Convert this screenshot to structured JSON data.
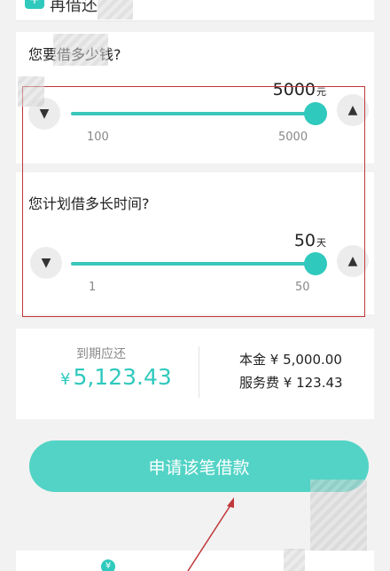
{
  "header": {
    "app_name": "再借还",
    "logo_icon": "plus-icon"
  },
  "amount": {
    "question": "您要借多少钱?",
    "value": "5000",
    "unit": "元",
    "min_label": "100",
    "max_label": "5000",
    "decrease_symbol": "▼",
    "increase_symbol": "▲",
    "level": 1.0
  },
  "term": {
    "question": "您计划借多长时间?",
    "value": "50",
    "unit": "天",
    "min_label": "1",
    "max_label": "50",
    "decrease_symbol": "▼",
    "increase_symbol": "▲",
    "level": 1.0
  },
  "summary": {
    "due_label": "到期应还",
    "currency": "¥",
    "due_amount": "5,123.43",
    "principal": "本金 ¥ 5,000.00",
    "service_fee": "服务费 ¥ 123.43"
  },
  "apply_button": "申请该笔借款",
  "bottom": {
    "coin_symbol": "¥"
  },
  "colors": {
    "accent": "#2fc9bd",
    "annotation": "#c0393b"
  }
}
